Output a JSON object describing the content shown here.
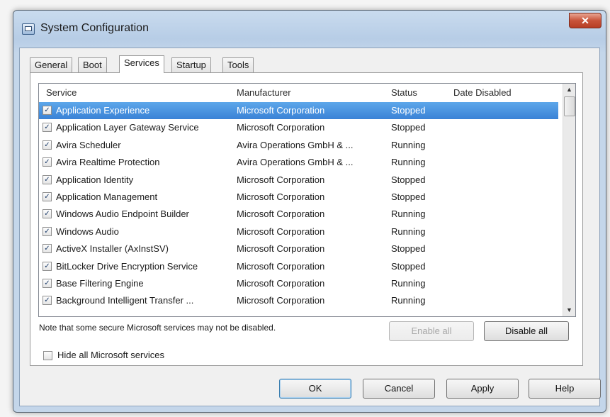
{
  "window": {
    "title": "System Configuration",
    "close": "✕"
  },
  "tabs": [
    "General",
    "Boot",
    "Services",
    "Startup",
    "Tools"
  ],
  "columns": {
    "service": "Service",
    "manufacturer": "Manufacturer",
    "status": "Status",
    "date_disabled": "Date Disabled"
  },
  "rows": [
    {
      "service": "Application Experience",
      "manufacturer": "Microsoft Corporation",
      "status": "Stopped",
      "date_disabled": "",
      "checked": true,
      "selected": true
    },
    {
      "service": "Application Layer Gateway Service",
      "manufacturer": "Microsoft Corporation",
      "status": "Stopped",
      "date_disabled": "",
      "checked": true
    },
    {
      "service": "Avira Scheduler",
      "manufacturer": "Avira Operations GmbH & ...",
      "status": "Running",
      "date_disabled": "",
      "checked": true
    },
    {
      "service": "Avira Realtime Protection",
      "manufacturer": "Avira Operations GmbH & ...",
      "status": "Running",
      "date_disabled": "",
      "checked": true
    },
    {
      "service": "Application Identity",
      "manufacturer": "Microsoft Corporation",
      "status": "Stopped",
      "date_disabled": "",
      "checked": true
    },
    {
      "service": "Application Management",
      "manufacturer": "Microsoft Corporation",
      "status": "Stopped",
      "date_disabled": "",
      "checked": true
    },
    {
      "service": "Windows Audio Endpoint Builder",
      "manufacturer": "Microsoft Corporation",
      "status": "Running",
      "date_disabled": "",
      "checked": true
    },
    {
      "service": "Windows Audio",
      "manufacturer": "Microsoft Corporation",
      "status": "Running",
      "date_disabled": "",
      "checked": true
    },
    {
      "service": "ActiveX Installer (AxInstSV)",
      "manufacturer": "Microsoft Corporation",
      "status": "Stopped",
      "date_disabled": "",
      "checked": true
    },
    {
      "service": "BitLocker Drive Encryption Service",
      "manufacturer": "Microsoft Corporation",
      "status": "Stopped",
      "date_disabled": "",
      "checked": true
    },
    {
      "service": "Base Filtering Engine",
      "manufacturer": "Microsoft Corporation",
      "status": "Running",
      "date_disabled": "",
      "checked": true
    },
    {
      "service": "Background Intelligent Transfer ...",
      "manufacturer": "Microsoft Corporation",
      "status": "Running",
      "date_disabled": "",
      "checked": true
    }
  ],
  "note": "Note that some secure Microsoft services may not be disabled.",
  "enable_all": "Enable all",
  "disable_all": "Disable all",
  "hide_ms": "Hide all Microsoft services",
  "buttons": {
    "ok": "OK",
    "cancel": "Cancel",
    "apply": "Apply",
    "help": "Help"
  },
  "icons": {
    "checkmark": "✓",
    "scroll_up": "▲",
    "scroll_down": "▼"
  }
}
